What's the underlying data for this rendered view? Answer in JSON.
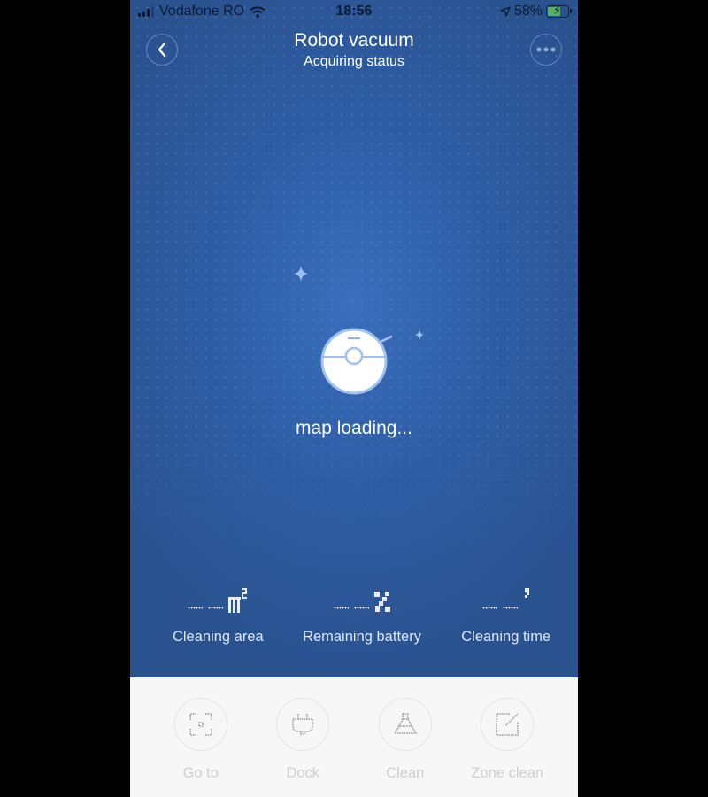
{
  "status_bar": {
    "carrier": "Vodafone RO",
    "time": "18:56",
    "battery_percent_label": "58%",
    "battery_level": 0.58,
    "icons": [
      "signal-icon",
      "wifi-icon",
      "location-arrow-icon",
      "battery-charging-icon"
    ]
  },
  "header": {
    "title": "Robot vacuum",
    "subtitle": "Acquiring status",
    "back_icon": "chevron-left-icon",
    "more_icon": "more-dots-icon"
  },
  "map": {
    "loading_text": "map loading...",
    "illustration": "robot-vacuum-icon"
  },
  "stats": [
    {
      "value": "-- --",
      "unit": "m²",
      "label": "Cleaning area"
    },
    {
      "value": "-- --",
      "unit": "%",
      "label": "Remaining battery"
    },
    {
      "value": "-- --",
      "unit": "′",
      "label": "Cleaning time"
    }
  ],
  "actions": [
    {
      "label": "Go to",
      "icon": "target-icon"
    },
    {
      "label": "Dock",
      "icon": "plug-icon"
    },
    {
      "label": "Clean",
      "icon": "broom-icon"
    },
    {
      "label": "Zone clean",
      "icon": "zone-icon"
    }
  ],
  "colors": {
    "main_bg": "#2f5ea6",
    "bottom_bg": "#f7f7f7",
    "disabled_text": "#cfcfcf",
    "battery_fill": "#5cc05c"
  }
}
